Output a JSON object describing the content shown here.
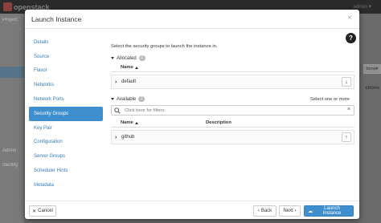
{
  "background": {
    "brand": "openstack",
    "project_label": "Project",
    "user_label": "admin",
    "sidebar_items": [
      "Project",
      "Admin",
      "Identity"
    ],
    "right_button": "tions",
    "right_label": "ctions"
  },
  "modal": {
    "title": "Launch Instance",
    "close_label": "×",
    "help_label": "?",
    "instructions": "Select the security groups to launch the instance in.",
    "nav": [
      {
        "label": "Details",
        "active": false
      },
      {
        "label": "Source",
        "active": false
      },
      {
        "label": "Flavor",
        "active": false
      },
      {
        "label": "Networks",
        "active": false
      },
      {
        "label": "Network Ports",
        "active": false
      },
      {
        "label": "Security Groups",
        "active": true
      },
      {
        "label": "Key Pair",
        "active": false
      },
      {
        "label": "Configuration",
        "active": false
      },
      {
        "label": "Server Groups",
        "active": false
      },
      {
        "label": "Scheduler Hints",
        "active": false
      },
      {
        "label": "Metadata",
        "active": false
      }
    ],
    "allocated": {
      "label": "Allocated",
      "count": "1",
      "columns": [
        "Name"
      ],
      "rows": [
        {
          "name": "default",
          "action": "↓"
        }
      ]
    },
    "available": {
      "label": "Available",
      "count": "1",
      "hint": "Select one or more",
      "filter_placeholder": "Click here for filters.",
      "filter_clear": "×",
      "columns": [
        "Name",
        "Description"
      ],
      "rows": [
        {
          "name": "github",
          "description": "",
          "action": "↑"
        }
      ]
    },
    "footer": {
      "cancel_label": "Cancel",
      "back_label": "Back",
      "next_label": "Next",
      "launch_label": "Launch Instance"
    },
    "accent_color": "#3f8fcf"
  }
}
